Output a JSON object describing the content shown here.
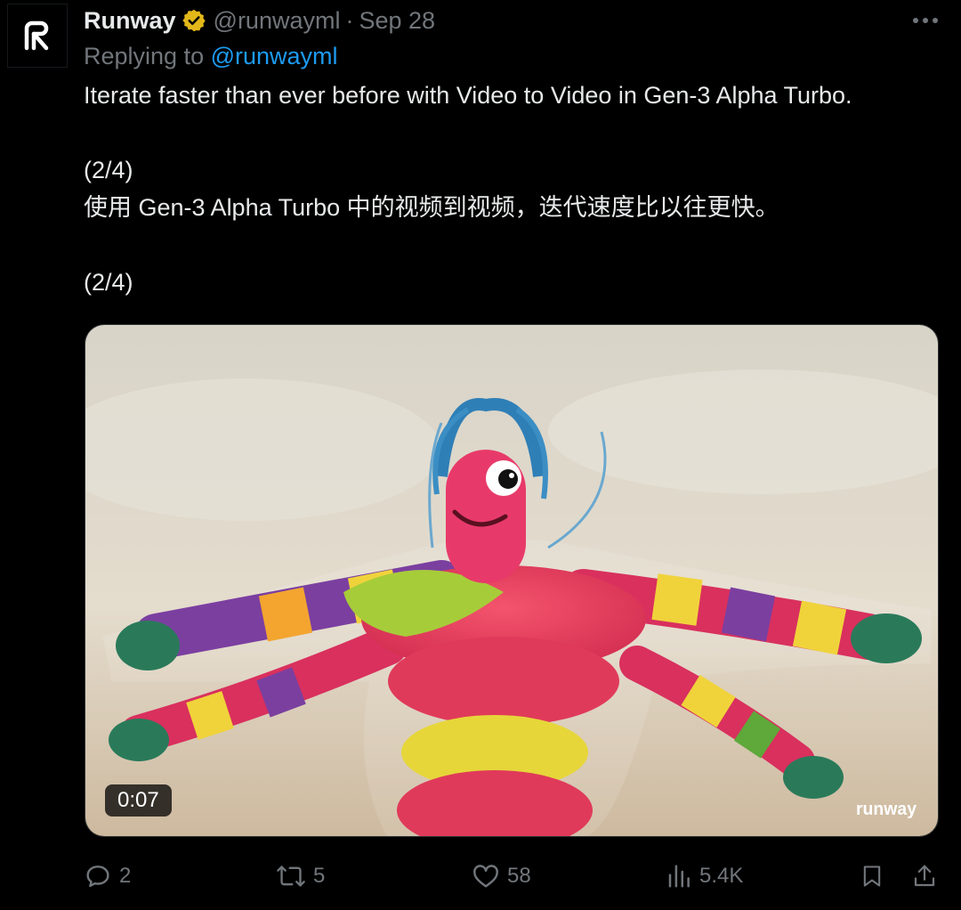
{
  "tweet": {
    "author": {
      "name": "Runway",
      "handle": "@runwayml",
      "verified": true,
      "verified_color": "#e2b719"
    },
    "separator": "·",
    "date": "Sep 28",
    "reply": {
      "prefix": "Replying to ",
      "target": "@runwayml"
    },
    "lines": [
      "Iterate faster than ever before with Video to Video in Gen-3 Alpha Turbo.",
      "",
      "(2/4)",
      "使用 Gen-3 Alpha Turbo 中的视频到视频，迭代速度比以往更快。",
      "",
      "(2/4)"
    ],
    "media": {
      "type": "video",
      "duration": "0:07",
      "watermark": "runway"
    },
    "actions": {
      "replies": "2",
      "reposts": "5",
      "likes": "58",
      "views": "5.4K"
    }
  },
  "colors": {
    "background": "#000000",
    "text": "#e7e9ea",
    "muted": "#71767b",
    "link": "#1d9bf0"
  },
  "icons": [
    "runway-logo-icon",
    "verified-badge-icon",
    "more-icon",
    "reply-icon",
    "repost-icon",
    "like-icon",
    "views-icon",
    "bookmark-icon",
    "share-icon"
  ]
}
